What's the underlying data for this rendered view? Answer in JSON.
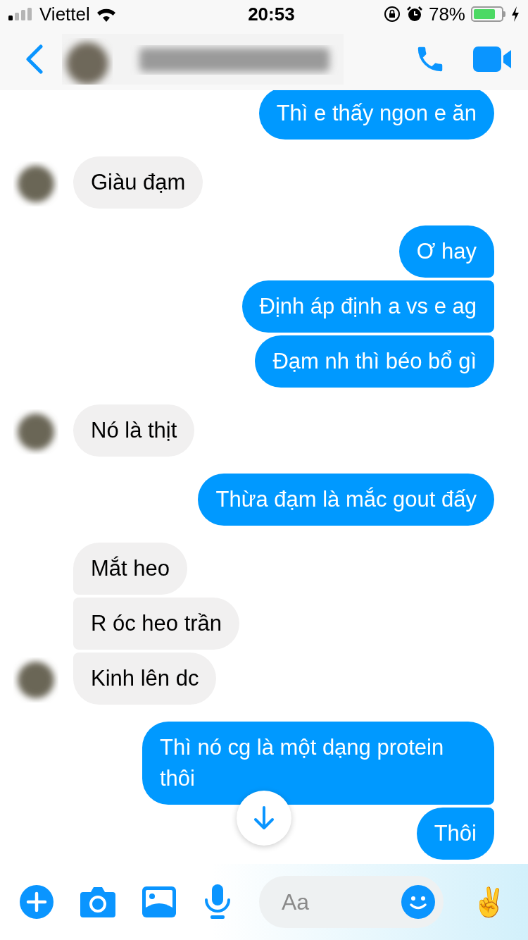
{
  "status_bar": {
    "carrier": "Viettel",
    "time": "20:53",
    "battery": "78%"
  },
  "messages": [
    {
      "kind": "sent",
      "text": "Thì e thấy ngon e ăn"
    },
    {
      "kind": "received",
      "text": "Giàu đạm"
    },
    {
      "kind": "sent",
      "text": "Ơ hay"
    },
    {
      "kind": "sent",
      "text": "Định áp định a vs e ag"
    },
    {
      "kind": "sent",
      "text": "Đạm nh thì béo bổ gì"
    },
    {
      "kind": "received",
      "text": "Nó là thịt"
    },
    {
      "kind": "sent",
      "text": "Thừa đạm là mắc gout đấy"
    },
    {
      "kind": "received",
      "text": "Mắt heo"
    },
    {
      "kind": "received",
      "text": "R óc heo trần"
    },
    {
      "kind": "received",
      "text": "Kinh lên dc"
    },
    {
      "kind": "sent",
      "text": "Thì nó cg là một dạng protein thôi"
    },
    {
      "kind": "sent",
      "text": "Thôi"
    }
  ],
  "composer": {
    "placeholder": "Aa",
    "quick_reaction": "✌️"
  }
}
